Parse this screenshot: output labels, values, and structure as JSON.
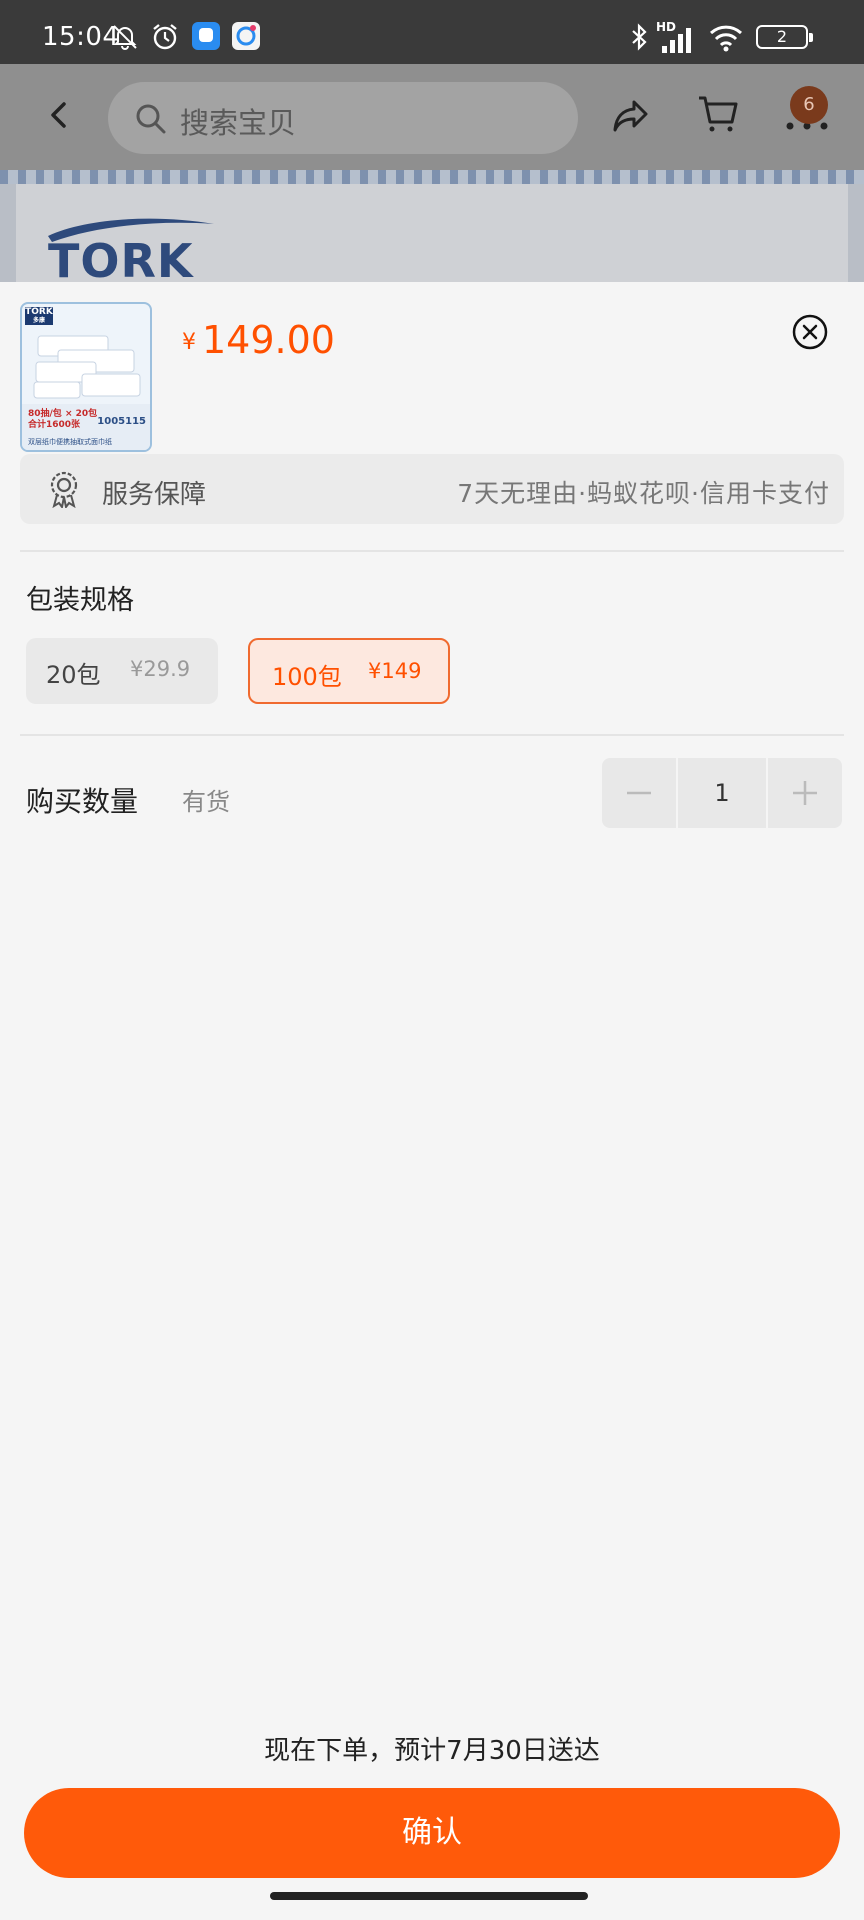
{
  "status_bar": {
    "time": "15:04",
    "battery": "2",
    "network": "HD"
  },
  "background": {
    "search_placeholder": "搜索宝贝",
    "cart_badge": "6",
    "banner_brand": "TORK"
  },
  "product": {
    "currency": "¥",
    "price": "149.00",
    "thumb": {
      "brand": "TORK",
      "brand_cn": "多康",
      "promo": "80抽/包 × 20包",
      "total": "合计1600张",
      "code": "1005115",
      "caption": "双层纸巾便携抽取式面巾纸"
    }
  },
  "service": {
    "label": "服务保障",
    "description": "7天无理由·蚂蚁花呗·信用卡支付"
  },
  "spec": {
    "title": "包装规格",
    "options": [
      {
        "name": "20包",
        "price": "¥29.9",
        "selected": false
      },
      {
        "name": "100包",
        "price": "¥149",
        "selected": true
      }
    ]
  },
  "quantity": {
    "label": "购买数量",
    "stock": "有货",
    "value": "1"
  },
  "footer": {
    "delivery": "现在下单，预计7月30日送达",
    "confirm": "确认"
  },
  "colors": {
    "accent": "#ff5000",
    "button": "#ff5a0a",
    "selected_bg": "#fde8df"
  }
}
